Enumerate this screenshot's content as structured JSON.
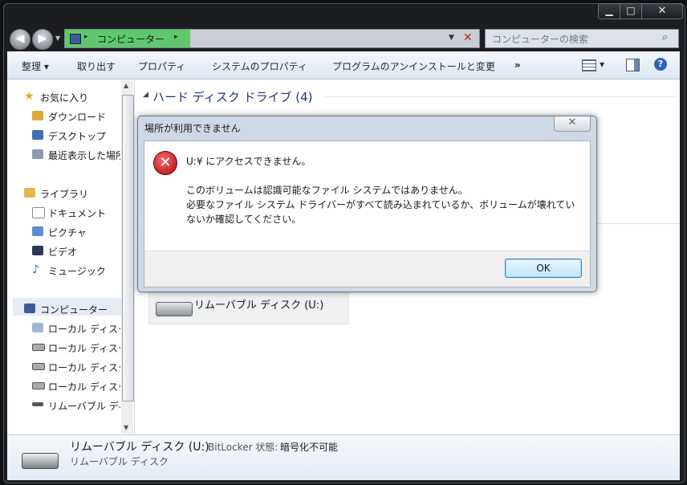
{
  "titlebar": {
    "min": "▁",
    "max": "□",
    "close": "✕"
  },
  "address": {
    "location": "コンピューター",
    "arrow": "▸"
  },
  "search": {
    "placeholder": "コンピューターの検索"
  },
  "toolbar": {
    "organize": "整理 ▾",
    "eject": "取り出す",
    "properties": "プロパティ",
    "system_properties": "システムのプロパティ",
    "uninstall": "プログラムのアンインストールと変更",
    "more": "»"
  },
  "nav": {
    "favorites": "お気に入り",
    "downloads": "ダウンロード",
    "desktop": "デスクトップ",
    "recent": "最近表示した場所",
    "libraries": "ライブラリ",
    "documents": "ドキュメント",
    "pictures": "ピクチャ",
    "videos": "ビデオ",
    "music": "ミュージック",
    "computer": "コンピューター",
    "local1": "ローカル ディスク",
    "local2": "ローカル ディスク",
    "local3": "ローカル ディスク",
    "local4": "ローカル ディスク",
    "removable": "リムーバブル ディスク"
  },
  "content": {
    "group_title": "ハード ディスク ドライブ (4)",
    "drive_label": "リムーバブル ディスク (U:)"
  },
  "details": {
    "name": "リムーバブル ディスク (U:)",
    "bitlocker_label": "BitLocker 状態:",
    "bitlocker_value": "暗号化不可能",
    "type": "リムーバブル ディスク"
  },
  "dialog": {
    "title": "場所が利用できません",
    "close": "✕",
    "heading": "U:¥ にアクセスできません。",
    "line1": "このボリュームは認識可能なファイル システムではありません。",
    "line2": "必要なファイル システム ドライバーがすべて読み込まれているか、ボリュームが壊れていないか確認してください。",
    "ok": "OK"
  }
}
